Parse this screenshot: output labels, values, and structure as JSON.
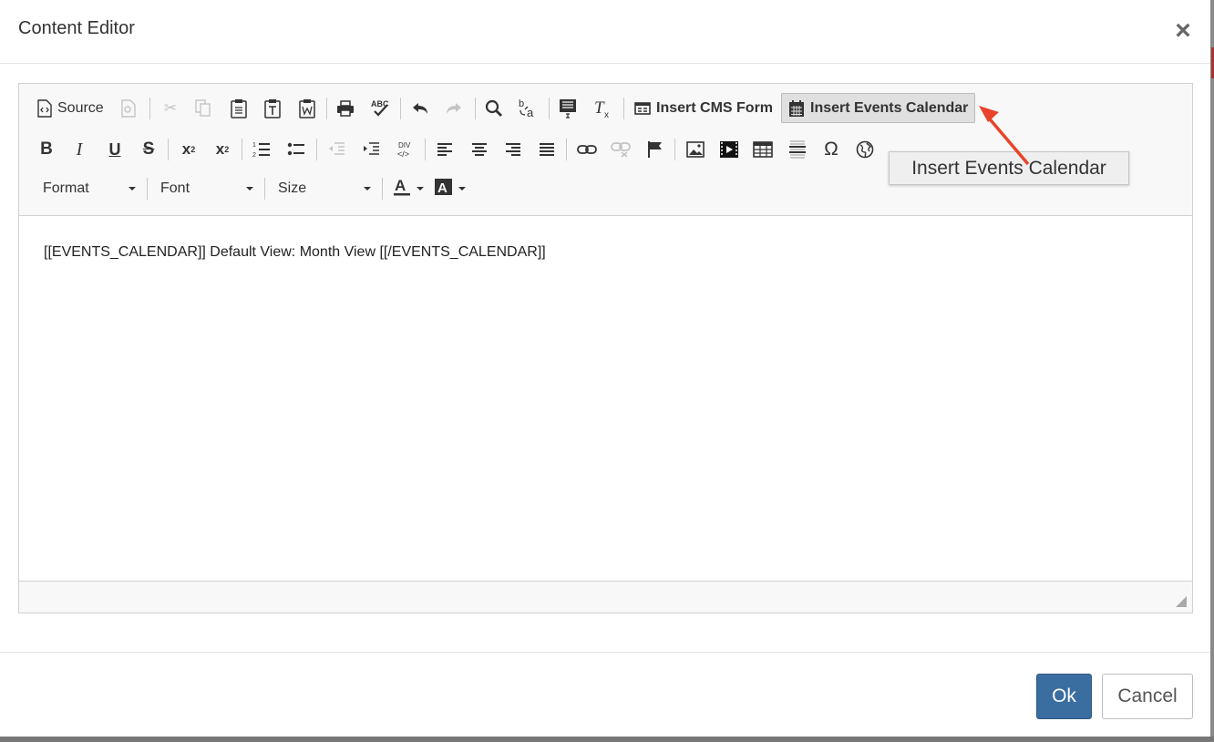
{
  "dialog": {
    "title": "Content Editor",
    "close_icon": "close-icon"
  },
  "toolbar": {
    "source_label": "Source",
    "insert_cms_form_label": "Insert CMS Form",
    "insert_events_calendar_label": "Insert Events Calendar",
    "format_label": "Format",
    "font_label": "Font",
    "size_label": "Size",
    "row1_icons": [
      "source-icon",
      "save-template-icon",
      "cut-icon",
      "copy-icon",
      "paste-icon",
      "paste-text-icon",
      "paste-from-word-icon",
      "print-icon",
      "spellcheck-icon",
      "undo-icon",
      "redo-icon",
      "find-icon",
      "replace-icon",
      "select-all-icon",
      "remove-format-icon",
      "form-icon",
      "calendar-icon"
    ],
    "row2_icons": [
      "bold-icon",
      "italic-icon",
      "underline-icon",
      "strikethrough-icon",
      "subscript-icon",
      "superscript-icon",
      "numbered-list-icon",
      "bulleted-list-icon",
      "outdent-icon",
      "indent-icon",
      "div-container-icon",
      "align-left-icon",
      "align-center-icon",
      "align-right-icon",
      "justify-icon",
      "link-icon",
      "unlink-icon",
      "anchor-flag-icon",
      "image-icon",
      "video-icon",
      "table-icon",
      "horizontal-line-icon",
      "special-char-icon",
      "iframe-globe-icon"
    ],
    "text_color_icon": "text-color-icon",
    "bg_color_icon": "background-color-icon"
  },
  "tooltip": {
    "text": "Insert Events Calendar"
  },
  "content": {
    "text": "[[EVENTS_CALENDAR]] Default View: Month View [[/EVENTS_CALENDAR]]"
  },
  "footer": {
    "ok_label": "Ok",
    "cancel_label": "Cancel"
  },
  "colors": {
    "primary_button": "#3a6ea0",
    "annotation_arrow": "#e8432a",
    "toolbar_bg": "#f8f8f8"
  }
}
